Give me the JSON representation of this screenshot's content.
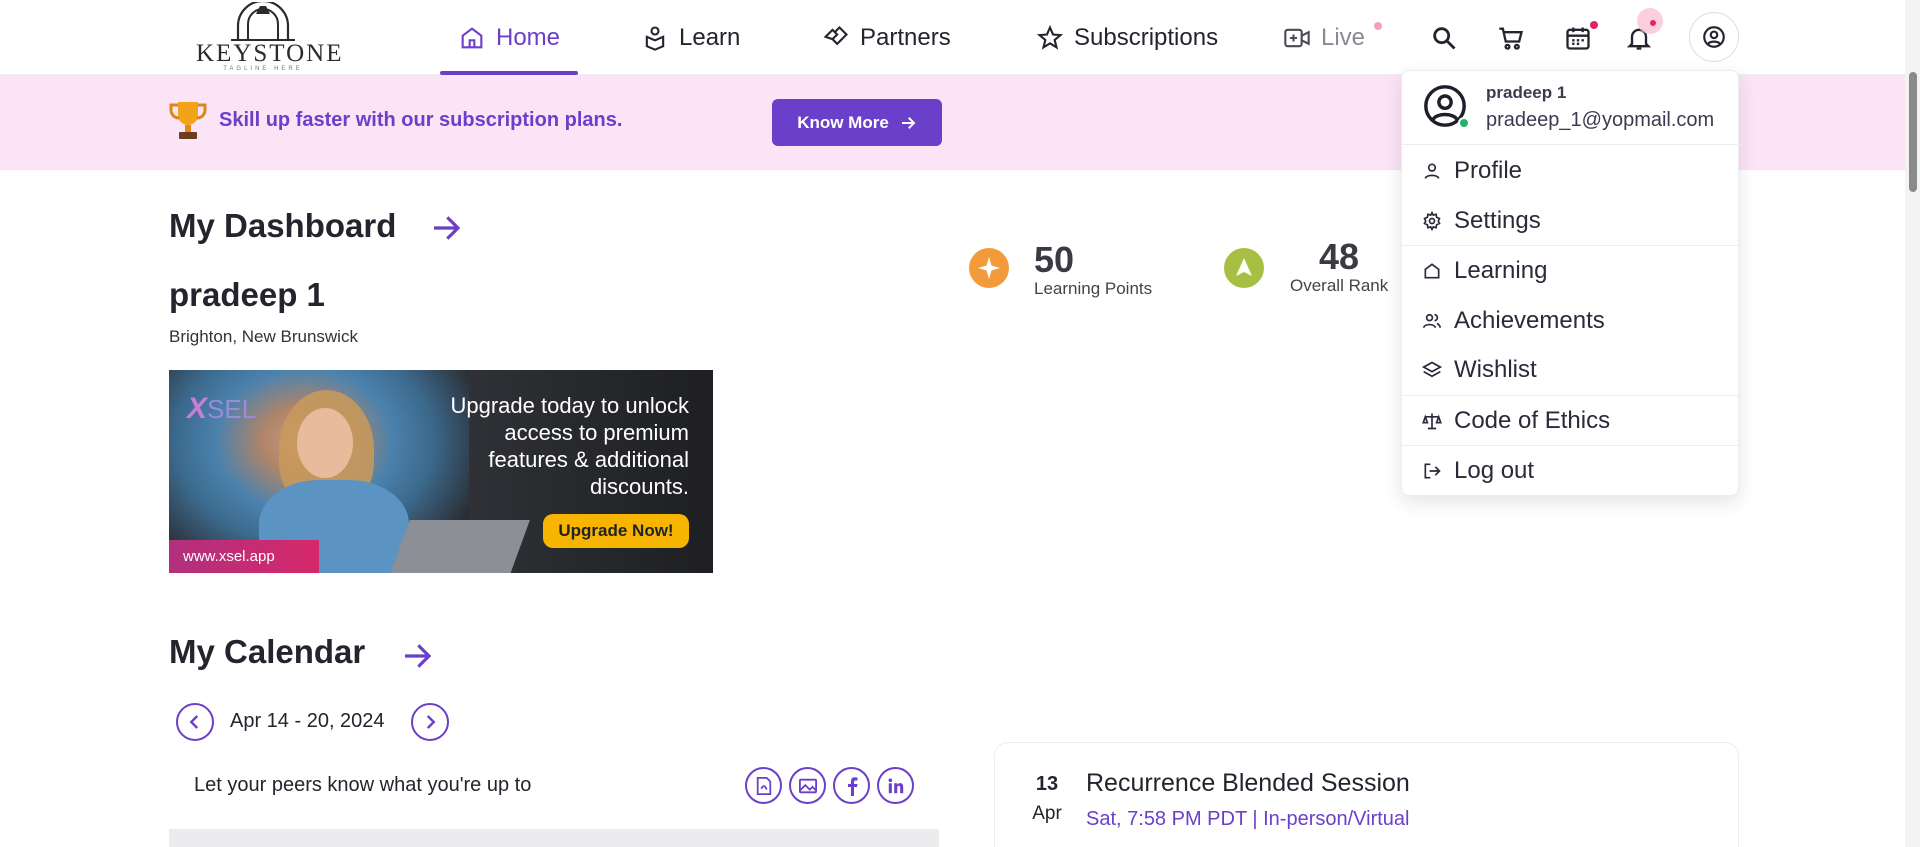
{
  "header": {
    "logo_text": "KEYSTONE",
    "logo_tagline": "TAGLINE HERE",
    "nav": [
      {
        "label": "Home",
        "icon": "home-icon",
        "active": true
      },
      {
        "label": "Learn",
        "icon": "learn-icon",
        "active": false
      },
      {
        "label": "Partners",
        "icon": "handshake-icon",
        "active": false
      },
      {
        "label": "Subscriptions",
        "icon": "star-icon",
        "active": false
      },
      {
        "label": "Live",
        "icon": "video-plus-icon",
        "active": false
      }
    ],
    "actions": [
      "search-icon",
      "cart-icon",
      "calendar-icon",
      "bell-icon",
      "user-circle-icon"
    ]
  },
  "banner": {
    "text": "Skill up faster with our subscription plans.",
    "button_label": "Know More"
  },
  "dashboard": {
    "title": "My Dashboard",
    "user_name": "pradeep 1",
    "location": "Brighton, New Brunswick",
    "promo": {
      "logo_x": "X",
      "logo_sel": "SEL",
      "text": "Upgrade today to unlock access to premium features & additional discounts.",
      "button_label": "Upgrade Now!",
      "url": "www.xsel.app"
    },
    "stats": [
      {
        "value": "50",
        "label": "Learning Points",
        "color": "#f39a3a"
      },
      {
        "value": "48",
        "label": "Overall Rank",
        "color": "#a7c044"
      }
    ]
  },
  "calendar": {
    "title": "My Calendar",
    "range": "Apr 14 - 20, 2024",
    "peers_text": "Let your peers know what you're up to",
    "share_icons": [
      "pdf-icon",
      "image-icon",
      "facebook-icon",
      "linkedin-icon"
    ],
    "event": {
      "day": "13",
      "month": "Apr",
      "title": "Recurrence Blended Session",
      "meta": "Sat, 7:58 PM PDT | In-person/Virtual"
    }
  },
  "user_menu": {
    "name": "pradeep 1",
    "email": "pradeep_1@yopmail.com",
    "items": [
      {
        "label": "Profile",
        "icon": "user-icon"
      },
      {
        "label": "Settings",
        "icon": "gear-icon"
      },
      {
        "label": "Learning",
        "icon": "home-icon"
      },
      {
        "label": "Achievements",
        "icon": "users-icon"
      },
      {
        "label": "Wishlist",
        "icon": "layers-icon"
      },
      {
        "label": "Code of Ethics",
        "icon": "scale-icon"
      },
      {
        "label": "Log out",
        "icon": "logout-icon"
      }
    ]
  },
  "colors": {
    "accent": "#6a3fc9",
    "banner_bg": "#fbe4f5",
    "promo_button": "#f7b400",
    "online": "#1fb36b"
  }
}
